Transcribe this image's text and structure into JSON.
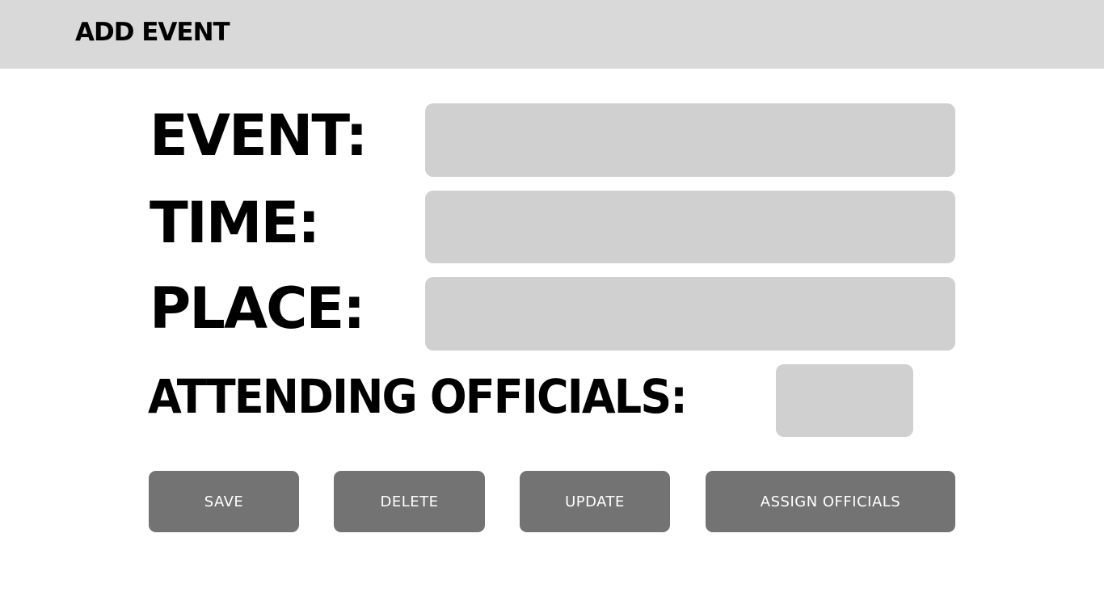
{
  "header": {
    "title": "ADD EVENT"
  },
  "form": {
    "event_label": "EVENT:",
    "event_value": "",
    "time_label": "TIME:",
    "time_value": "",
    "place_label": "PLACE:",
    "place_value": "",
    "officials_label": "ATTENDING OFFICIALS:",
    "officials_value": ""
  },
  "actions": {
    "save_label": "SAVE",
    "delete_label": "DELETE",
    "update_label": "UPDATE",
    "assign_label": "ASSIGN OFFICIALS"
  },
  "colors": {
    "header_bg": "#d9d9d9",
    "field_bg": "#d0d0d0",
    "button_bg": "#737373",
    "button_text": "#ffffff"
  }
}
